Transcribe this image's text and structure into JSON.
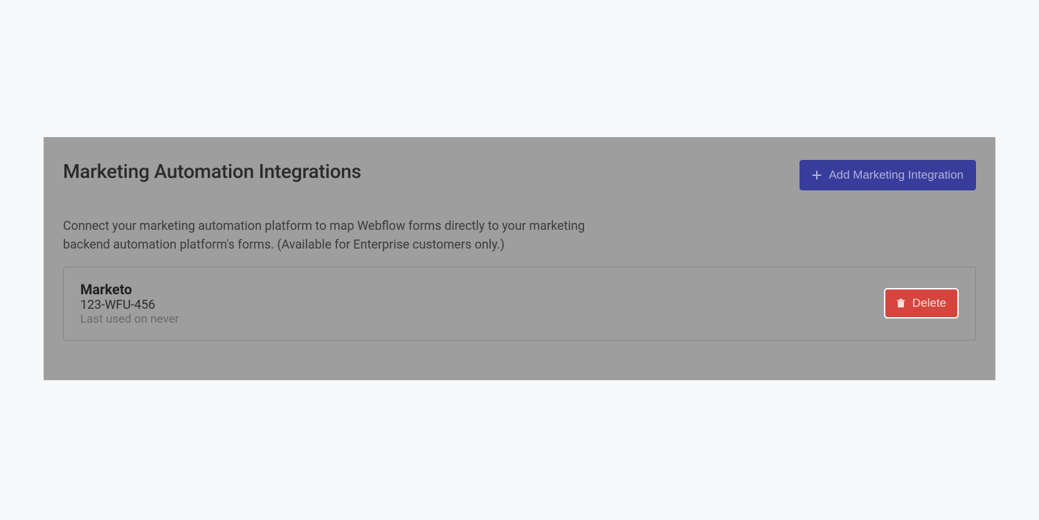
{
  "panel": {
    "title": "Marketing Automation Integrations",
    "add_button_label": "Add Marketing Integration",
    "description": "Connect your marketing automation platform to map Webflow forms directly to your marketing backend automation platform's forms. (Available for Enterprise customers only.)"
  },
  "integration": {
    "name": "Marketo",
    "id": "123-WFU-456",
    "last_used": "Last used on never",
    "delete_label": "Delete"
  }
}
